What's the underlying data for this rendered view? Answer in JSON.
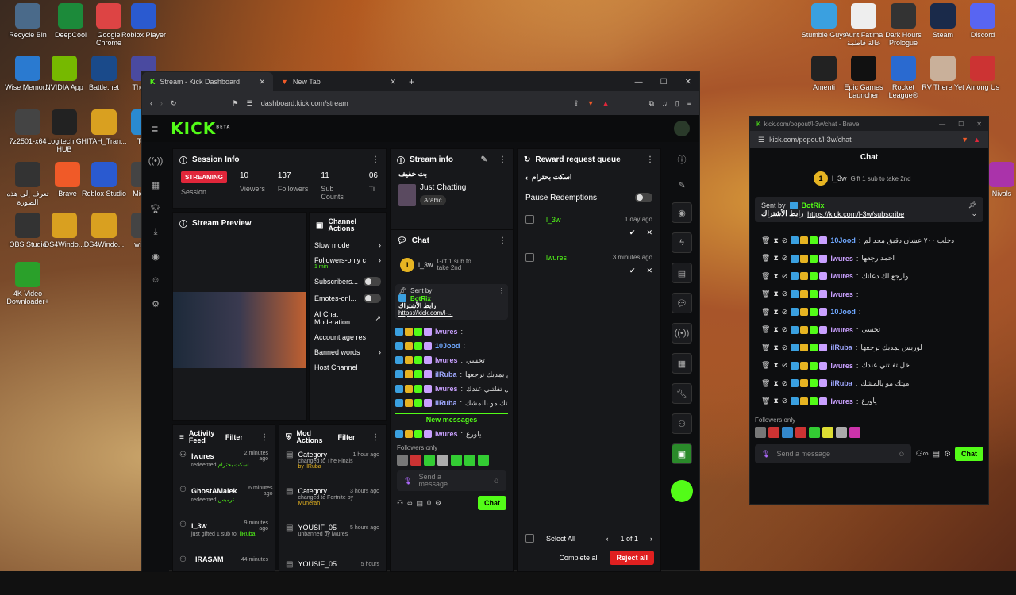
{
  "desktop": {
    "left_icons": [
      "Recycle Bin",
      "DeepCool",
      "Google Chrome",
      "Roblox Player",
      "Wise Memor...",
      "NVIDIA App",
      "Battle.net",
      "The Us",
      "7z2501-x64",
      "Logitech G HUB",
      "HITAH_Tran...",
      "Tele",
      "تعرف إلى هذه الصورة",
      "Brave",
      "Roblox Studio",
      "Mic Ed",
      "OBS Studio",
      "DS4Windo...",
      "DS4Windo...",
      "windo",
      "4K Video Downloader+"
    ],
    "right_icons": [
      "Stumble Guys",
      "Aunt Fatima خالة فاطمة",
      "Dark Hours Prologue",
      "Steam",
      "Discord",
      "Amenti",
      "Epic Games Launcher",
      "Rocket League®",
      "RV There Yet",
      "Among Us",
      "Nivals"
    ]
  },
  "browser": {
    "tab1": "Stream - Kick Dashboard",
    "tab2": "New Tab",
    "url": "dashboard.kick.com/stream",
    "plus": "+"
  },
  "kick": {
    "logo": "KICK",
    "logo_beta": "BETA"
  },
  "session": {
    "title": "Session Info",
    "streaming": "STREAMING",
    "session_label": "Session",
    "viewers": "10",
    "viewers_label": "Viewers",
    "followers": "137",
    "followers_label": "Followers",
    "subs": "11",
    "subs_label": "Sub Counts",
    "extra": "06",
    "extra_label": "Ti"
  },
  "preview": {
    "title": "Stream Preview"
  },
  "channel_actions": {
    "title": "Channel Actions",
    "slow": "Slow mode",
    "followers_only": "Followers-only c",
    "followers_sub": "1 min",
    "subscribers": "Subscribers...",
    "emotes": "Emotes-onl...",
    "ai": "AI Chat Moderation",
    "account_age": "Account age res",
    "banned": "Banned words",
    "host": "Host Channel"
  },
  "stream_info": {
    "title": "Stream info",
    "stream_title": "بث خفيف",
    "category": "Just Chatting",
    "tag": "Arabic"
  },
  "chat": {
    "title": "Chat",
    "gifter": "l_3w",
    "gifter_rank": "1",
    "gift_text": "Gift 1 sub to take 2nd",
    "sent_by": "Sent by",
    "bot": "BotRix",
    "pinned_text": "رابط الأشتراك",
    "pinned_link": "https://kick.com/l-...",
    "new_messages": "New messages",
    "followers_only": "Followers only",
    "placeholder": "Send a message",
    "chat_btn": "Chat",
    "count": "0",
    "messages": [
      {
        "user": "lwures",
        "color": "#c9a0ff",
        "text": ""
      },
      {
        "user": "10Jood",
        "color": "#6fa8ff",
        "text": ""
      },
      {
        "user": "lwures",
        "color": "#c9a0ff",
        "text": "تخسي"
      },
      {
        "user": "ilRuba",
        "color": "#9fa8ff",
        "text": "لوريس يمديك ترجعها"
      },
      {
        "user": "lwures",
        "color": "#c9a0ff",
        "text": "خل تفلتني عندك"
      },
      {
        "user": "ilRuba",
        "color": "#9fa8ff",
        "text": "ميتك مو بالمشك"
      },
      {
        "user": "lwures",
        "color": "#c9a0ff",
        "text": "ياورع"
      }
    ]
  },
  "reward": {
    "title": "Reward request queue",
    "reward_name": "اسكت بحترام",
    "pause": "Pause Redemptions",
    "items": [
      {
        "user": "l_3w",
        "time": "1 day ago",
        "color": "#53fc18"
      },
      {
        "user": "lwures",
        "time": "3 minutes ago",
        "color": "#53fc18"
      }
    ],
    "select_all": "Select All",
    "page": "1 of 1",
    "complete": "Complete all",
    "reject": "Reject all"
  },
  "activity": {
    "title": "Activity Feed",
    "filter": "Filter",
    "items": [
      {
        "user": "lwures",
        "time": "2 minutes ago",
        "action": "redeemed",
        "detail": "اسكت بحترام"
      },
      {
        "user": "GhostAMalek",
        "time": "6 minutes ago",
        "action": "redeemed",
        "detail": "ترميس"
      },
      {
        "user": "l_3w",
        "time": "9 minutes ago",
        "action": "just gifted 1 sub to:",
        "detail": "ilRuba"
      },
      {
        "user": "_IRASAM",
        "time": "44 minutes",
        "action": "",
        "detail": ""
      }
    ]
  },
  "mod": {
    "title": "Mod Actions",
    "filter": "Filter",
    "items": [
      {
        "head": "Category",
        "time": "1 hour ago",
        "l1": "changed to The Finals",
        "l2": "by ilRuba"
      },
      {
        "head": "Category",
        "time": "3 hours ago",
        "l1": "changed to Fortnite by",
        "l2": "Munerah"
      },
      {
        "head": "YOUSIF_05",
        "time": "5 hours ago",
        "l1": "unbanned by lwures",
        "l2": ""
      },
      {
        "head": "YOUSIF_05",
        "time": "5 hours",
        "l1": "",
        "l2": ""
      }
    ]
  },
  "popout": {
    "title": "kick.com/popout/l-3w/chat - Brave",
    "url": "kick.com/popout/l-3w/chat",
    "chat_title": "Chat",
    "gifter": "l_3w",
    "rank": "1",
    "gift": "Gift 1 sub to take 2nd",
    "sent_by": "Sent by",
    "bot": "BotRix",
    "pinned_text": "رابط الأشتراك",
    "pinned_link": "https://kick.com/l-3w/subscribe",
    "followers_only": "Followers only",
    "placeholder": "Send a message",
    "chat_btn": "Chat",
    "messages": [
      {
        "user": "10Jood",
        "color": "#6fa8ff",
        "text": "دخلت ٧٠٠ عشان دقيق محد لم"
      },
      {
        "user": "lwures",
        "color": "#c9a0ff",
        "text": "احمد رجعها"
      },
      {
        "user": "lwures",
        "color": "#c9a0ff",
        "text": "وارجع لك دعائك"
      },
      {
        "user": "lwures",
        "color": "#c9a0ff",
        "text": ""
      },
      {
        "user": "10Jood",
        "color": "#6fa8ff",
        "text": ""
      },
      {
        "user": "lwures",
        "color": "#c9a0ff",
        "text": "تخسي"
      },
      {
        "user": "ilRuba",
        "color": "#9fa8ff",
        "text": "لوريس يمديك ترجعها"
      },
      {
        "user": "lwures",
        "color": "#c9a0ff",
        "text": "خل تفلتني عندك"
      },
      {
        "user": "ilRuba",
        "color": "#9fa8ff",
        "text": "ميتك مو بالمشك"
      },
      {
        "user": "lwures",
        "color": "#c9a0ff",
        "text": "ياورع"
      }
    ]
  },
  "colors": {
    "accent": "#53fc18",
    "danger": "#e02020",
    "streaming": "#e0263a"
  }
}
